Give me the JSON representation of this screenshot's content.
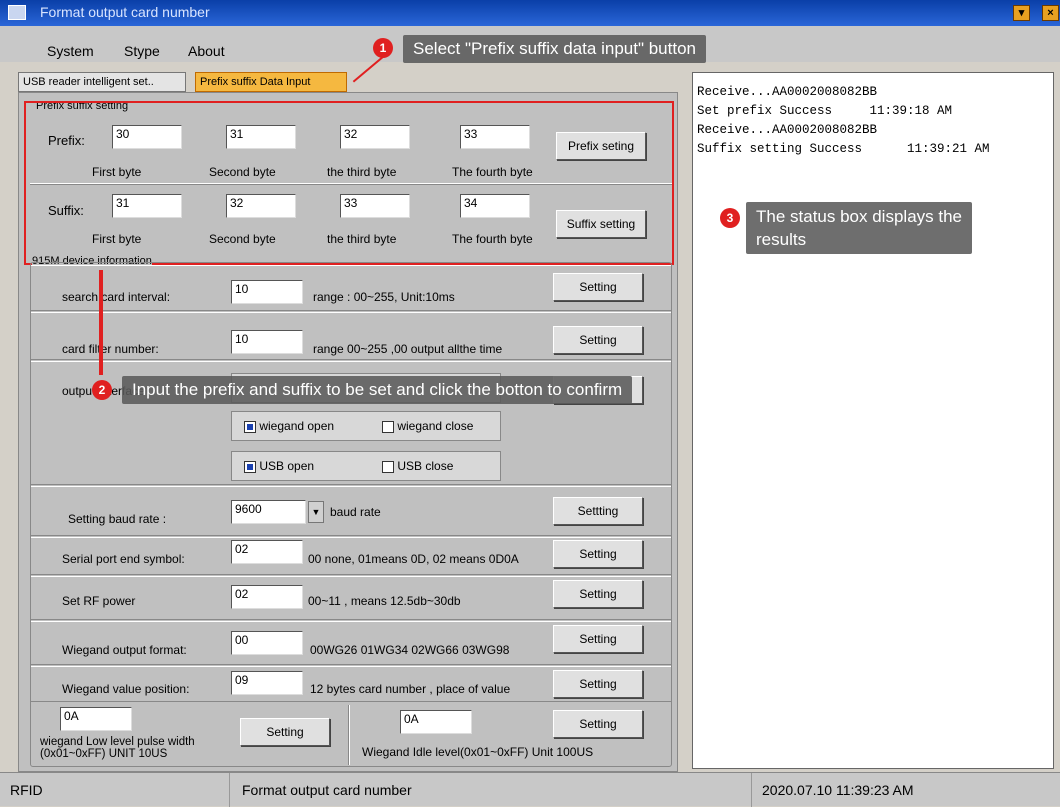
{
  "window": {
    "title": "Format output  card number"
  },
  "menu": [
    "System",
    "Stype",
    "About"
  ],
  "tabs": [
    "USB reader intelligent set..",
    "Prefix suffix Data Input"
  ],
  "prefix_group": {
    "legend": "Prefix suffix setting",
    "prefix_label": "Prefix:",
    "prefix_values": [
      "30",
      "31",
      "32",
      "33"
    ],
    "byte_labels": [
      "First byte",
      "Second byte",
      "the third byte",
      "The fourth byte"
    ],
    "prefix_button": "Prefix seting",
    "suffix_label": "Suffix:",
    "suffix_values": [
      "31",
      "32",
      "33",
      "34"
    ],
    "suffix_button": "Suffix setting"
  },
  "device_group": {
    "legend": "915M device information"
  },
  "rows": {
    "search": {
      "label": "search card interval:",
      "value": "10",
      "hint": "range : 00~255, Unit:10ms",
      "button": "Setting"
    },
    "filter": {
      "label": "card filter number:",
      "value": "10",
      "hint": "range  00~255 ,00 output allthe time",
      "button": "Setting"
    },
    "output": {
      "label": "output interface"
    },
    "wiegand_open": "wiegand open",
    "wiegand_close": "wiegand close",
    "usb_open": "USB open",
    "usb_close": "USB close",
    "baud": {
      "label": "Setting baud rate :",
      "value": "9600",
      "hint": "baud rate",
      "button": "Settting"
    },
    "serial": {
      "label": "Serial port end symbol:",
      "value": "02",
      "hint": "00 none, 01means 0D,  02 means 0D0A",
      "button": "Setting"
    },
    "rf": {
      "label": "Set RF power",
      "value": "02",
      "hint": "00~11 ,  means 12.5db~30db",
      "button": "Setting"
    },
    "wformat": {
      "label": "Wiegand output format:",
      "value": "00",
      "hint": "00WG26 01WG34 02WG66 03WG98",
      "button": "Setting"
    },
    "wpos": {
      "label": "Wiegand value position:",
      "value": "09",
      "hint": "12 bytes card number ,  place of value",
      "button": "Setting"
    },
    "low": {
      "value": "0A",
      "label": "wiegand Low level pulse width (0x01~0xFF) UNIT 10US",
      "button": "Setting"
    },
    "idle": {
      "value": "0A",
      "label": "Wiegand Idle level(0x01~0xFF) Unit 100US",
      "button": "Setting"
    }
  },
  "status_lines": [
    "Receive...AA0002008082BB",
    "Set prefix Success     11:39:18 AM",
    "",
    "Receive...AA0002008082BB",
    "Suffix setting Success      11:39:21 AM"
  ],
  "statusbar": [
    "RFID",
    "Format output  card number",
    "2020.07.10  11:39:23 AM"
  ],
  "callouts": {
    "c1_num": "1",
    "c1": "Select \"Prefix suffix data input\" button",
    "c2_num": "2",
    "c2": "Input the prefix and suffix to be set and click the botton to confirm",
    "c3_num": "3",
    "c3a": "The status box displays the",
    "c3b": "results"
  }
}
